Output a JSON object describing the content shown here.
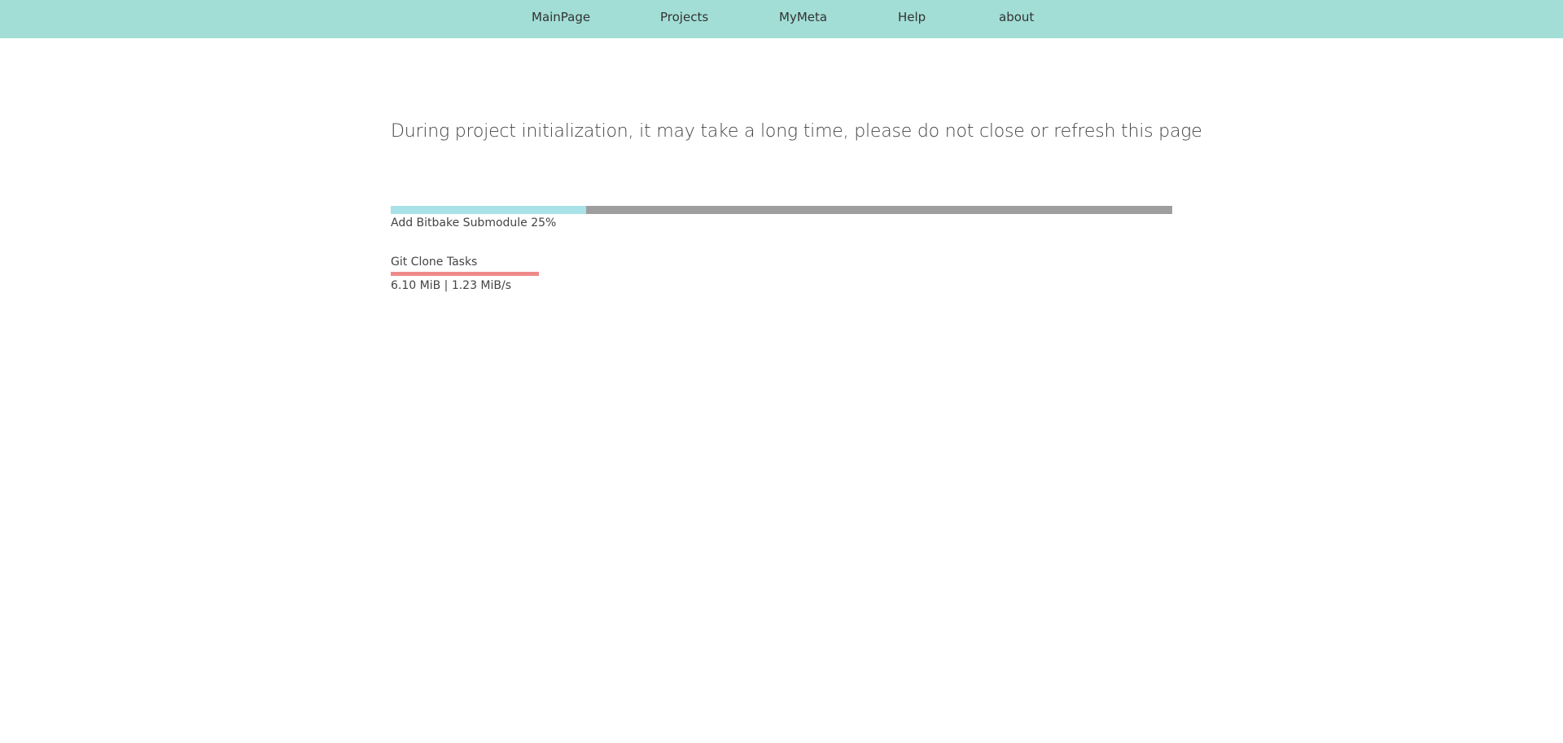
{
  "nav": {
    "items": [
      {
        "label": "MainPage"
      },
      {
        "label": "Projects"
      },
      {
        "label": "MyMeta"
      },
      {
        "label": "Help"
      },
      {
        "label": "about"
      }
    ]
  },
  "main": {
    "message": "During project initialization, it may take a long time, please do not close or refresh this page",
    "progress": {
      "label": "Add Bitbake Submodule 25%",
      "percent": 25
    },
    "task": {
      "title": "Git Clone Tasks",
      "stats": "6.10 MiB | 1.23 MiB/s"
    }
  },
  "colors": {
    "nav_bg": "#a2ded6",
    "progress_fill": "#a8e2e8",
    "progress_track": "#9e9e9e",
    "task_bar": "#f08a8a"
  }
}
